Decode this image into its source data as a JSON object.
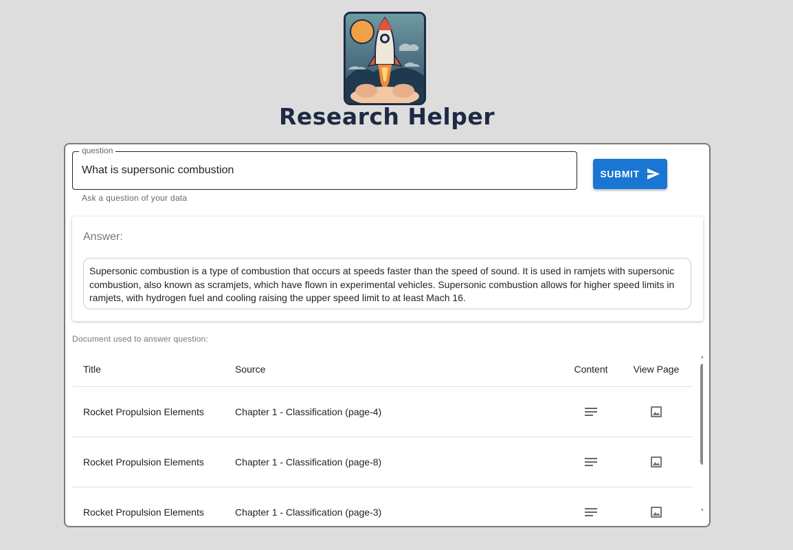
{
  "app": {
    "title": "Research Helper"
  },
  "question": {
    "label": "question",
    "value": "What is supersonic combustion",
    "helper": "Ask a question of your data"
  },
  "submit": {
    "label": "SUBMIT",
    "icon": "send-icon"
  },
  "answer": {
    "heading": "Answer:",
    "text": "Supersonic combustion is a type of combustion that occurs at speeds faster than the speed of sound. It is used in ramjets with supersonic combustion, also known as scramjets, which have flown in experimental vehicles. Supersonic combustion allows for higher speed limits in ramjets, with hydrogen fuel and cooling raising the upper speed limit to at least Mach 16."
  },
  "documents": {
    "label": "Document used to answer question:",
    "columns": [
      "Title",
      "Source",
      "Content",
      "View Page"
    ],
    "rows": [
      {
        "title": "Rocket Propulsion Elements",
        "source": "Chapter 1 - Classification (page-4)",
        "content_icon": "text-lines-icon",
        "view_icon": "image-icon"
      },
      {
        "title": "Rocket Propulsion Elements",
        "source": "Chapter 1 - Classification (page-8)",
        "content_icon": "text-lines-icon",
        "view_icon": "image-icon"
      },
      {
        "title": "Rocket Propulsion Elements",
        "source": "Chapter 1 - Classification (page-3)",
        "content_icon": "text-lines-icon",
        "view_icon": "image-icon"
      }
    ]
  },
  "colors": {
    "accent": "#1976d2",
    "background": "#dddddd",
    "title": "#1e2a44"
  }
}
